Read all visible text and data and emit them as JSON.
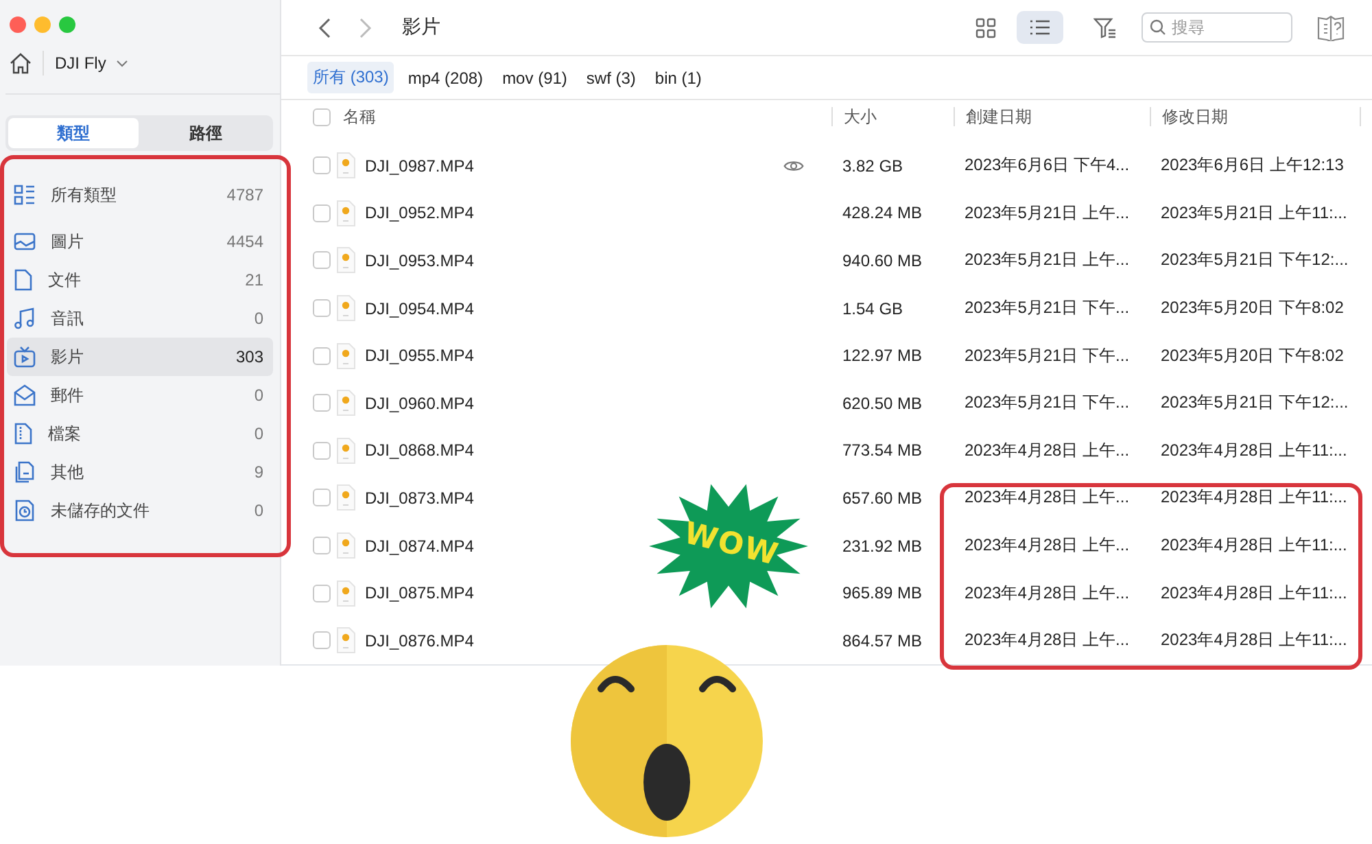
{
  "location": {
    "label": "DJI Fly"
  },
  "sidebar": {
    "tabs": [
      {
        "label": "類型",
        "selected": true
      },
      {
        "label": "路徑",
        "selected": false
      }
    ],
    "items": [
      {
        "label": "所有類型",
        "count": "4787",
        "selected": false
      },
      {
        "label": "圖片",
        "count": "4454",
        "selected": false
      },
      {
        "label": "文件",
        "count": "21",
        "selected": false
      },
      {
        "label": "音訊",
        "count": "0",
        "selected": false
      },
      {
        "label": "影片",
        "count": "303",
        "selected": true
      },
      {
        "label": "郵件",
        "count": "0",
        "selected": false
      },
      {
        "label": "檔案",
        "count": "0",
        "selected": false
      },
      {
        "label": "其他",
        "count": "9",
        "selected": false
      },
      {
        "label": "未儲存的文件",
        "count": "0",
        "selected": false
      }
    ]
  },
  "toolbar": {
    "title": "影片",
    "view_modes": [
      {
        "kind": "grid",
        "selected": false
      },
      {
        "kind": "list",
        "selected": true
      }
    ],
    "search": {
      "placeholder": "搜尋"
    }
  },
  "filters": [
    {
      "label": "所有 (303)",
      "selected": true
    },
    {
      "label": "mp4 (208)",
      "selected": false
    },
    {
      "label": "mov (91)",
      "selected": false
    },
    {
      "label": "swf (3)",
      "selected": false
    },
    {
      "label": "bin (1)",
      "selected": false
    }
  ],
  "table": {
    "columns": [
      "名稱",
      "大小",
      "創建日期",
      "修改日期"
    ],
    "all_checked": false,
    "rows": [
      {
        "name": "DJI_0987.MP4",
        "size": "3.82 GB",
        "created": "2023年6月6日 下午4...",
        "modified": "2023年6月6日 上午12:13",
        "checked": false,
        "preview": true
      },
      {
        "name": "DJI_0952.MP4",
        "size": "428.24 MB",
        "created": "2023年5月21日 上午...",
        "modified": "2023年5月21日 上午11:...",
        "checked": false,
        "preview": false
      },
      {
        "name": "DJI_0953.MP4",
        "size": "940.60 MB",
        "created": "2023年5月21日 上午...",
        "modified": "2023年5月21日 下午12:...",
        "checked": false,
        "preview": false
      },
      {
        "name": "DJI_0954.MP4",
        "size": "1.54 GB",
        "created": "2023年5月21日 下午...",
        "modified": "2023年5月20日 下午8:02",
        "checked": false,
        "preview": false
      },
      {
        "name": "DJI_0955.MP4",
        "size": "122.97 MB",
        "created": "2023年5月21日 下午...",
        "modified": "2023年5月20日 下午8:02",
        "checked": false,
        "preview": false
      },
      {
        "name": "DJI_0960.MP4",
        "size": "620.50 MB",
        "created": "2023年5月21日 下午...",
        "modified": "2023年5月21日 下午12:...",
        "checked": false,
        "preview": false
      },
      {
        "name": "DJI_0868.MP4",
        "size": "773.54 MB",
        "created": "2023年4月28日 上午...",
        "modified": "2023年4月28日 上午11:...",
        "checked": false,
        "preview": false
      },
      {
        "name": "DJI_0873.MP4",
        "size": "657.60 MB",
        "created": "2023年4月28日 上午...",
        "modified": "2023年4月28日 上午11:...",
        "checked": false,
        "preview": false
      },
      {
        "name": "DJI_0874.MP4",
        "size": "231.92 MB",
        "created": "2023年4月28日 上午...",
        "modified": "2023年4月28日 上午11:...",
        "checked": false,
        "preview": false
      },
      {
        "name": "DJI_0875.MP4",
        "size": "965.89 MB",
        "created": "2023年4月28日 上午...",
        "modified": "2023年4月28日 上午11:...",
        "checked": false,
        "preview": false
      },
      {
        "name": "DJI_0876.MP4",
        "size": "864.57 MB",
        "created": "2023年4月28日 上午...",
        "modified": "2023年4月28日 上午11:...",
        "checked": false,
        "preview": false
      }
    ]
  },
  "annotations": {
    "sticker": {
      "text": "WOW"
    }
  }
}
